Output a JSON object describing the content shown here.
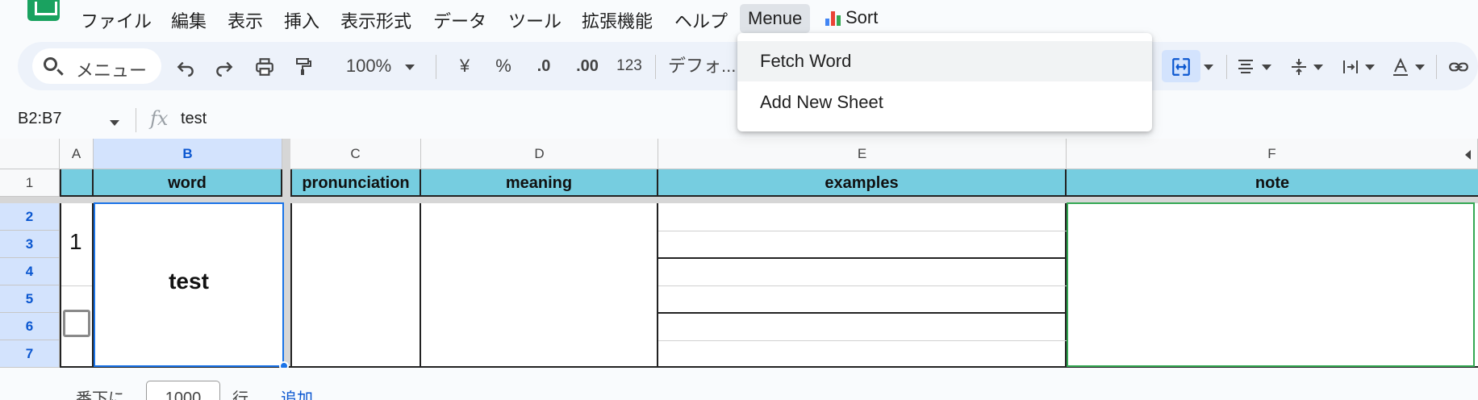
{
  "menubar": {
    "items": [
      "ファイル",
      "編集",
      "表示",
      "挿入",
      "表示形式",
      "データ",
      "ツール",
      "拡張機能",
      "ヘルプ"
    ],
    "active_menu": "Menue",
    "sort_label": "Sort"
  },
  "toolbar": {
    "search_placeholder": "メニュー",
    "zoom": "100%",
    "currency": "¥",
    "percent": "%",
    "decimal_decrease": ".0",
    "decimal_increase": ".00",
    "number_format": "123",
    "font": "デフォ..."
  },
  "formula_bar": {
    "range": "B2:B7",
    "fx": "fx",
    "value": "test"
  },
  "columns": [
    "A",
    "B",
    "C",
    "D",
    "E",
    "F"
  ],
  "rows": [
    "1",
    "2",
    "3",
    "4",
    "5",
    "6",
    "7"
  ],
  "header_row": {
    "word": "word",
    "pronunciation": "pronunciation",
    "meaning": "meaning",
    "examples": "examples",
    "note": "note"
  },
  "entry": {
    "number": "1",
    "word": "test",
    "checkbox_checked": false
  },
  "footer": {
    "label": "番下に",
    "count": "1000",
    "unit": "行",
    "add": "追加"
  },
  "dropdown": {
    "items": [
      "Fetch Word",
      "Add New Sheet"
    ]
  },
  "colors": {
    "header_fill": "#76cde0",
    "selection": "#1a73e8",
    "note_border": "#34a853",
    "header_selected": "#d3e3fd"
  }
}
